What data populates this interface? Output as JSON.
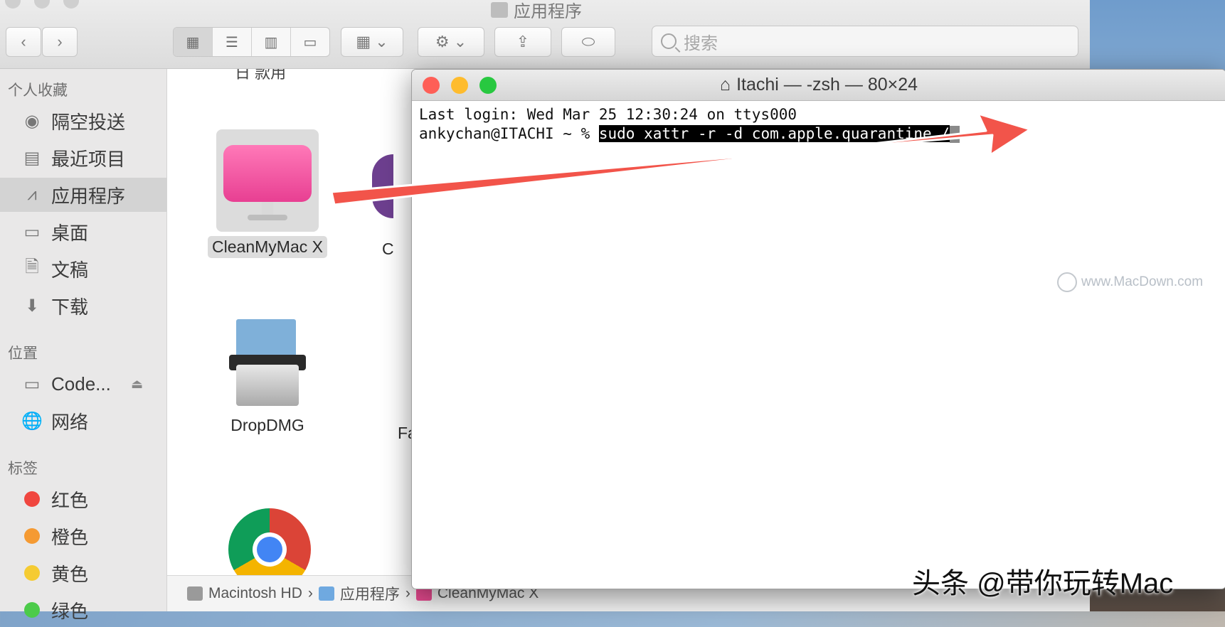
{
  "finder": {
    "title": "应用程序",
    "search_placeholder": "搜索",
    "sidebar": {
      "favorites_title": "个人收藏",
      "favorites": [
        {
          "label": "隔空投送",
          "icon": "airdrop-icon"
        },
        {
          "label": "最近项目",
          "icon": "recents-icon"
        },
        {
          "label": "应用程序",
          "icon": "applications-icon"
        },
        {
          "label": "桌面",
          "icon": "desktop-icon"
        },
        {
          "label": "文稿",
          "icon": "documents-icon"
        },
        {
          "label": "下载",
          "icon": "downloads-icon"
        }
      ],
      "locations_title": "位置",
      "locations": [
        {
          "label": "Code...",
          "icon": "disk-icon"
        },
        {
          "label": "网络",
          "icon": "network-icon"
        }
      ],
      "tags_title": "标签",
      "tags": [
        {
          "label": "红色",
          "color": "#f0463f"
        },
        {
          "label": "橙色",
          "color": "#f59a32"
        },
        {
          "label": "黄色",
          "color": "#f5cb32"
        },
        {
          "label": "绿色",
          "color": "#4ccb4a"
        }
      ]
    },
    "apps": [
      {
        "label": "CleanMyMac X"
      },
      {
        "label": "C"
      },
      {
        "label": "DropDMG"
      },
      {
        "label": "Fa"
      }
    ],
    "pathbar": [
      "Macintosh HD",
      "应用程序",
      "CleanMyMac X"
    ],
    "partial_top_label": "日 款用"
  },
  "terminal": {
    "title": "Itachi — -zsh — 80×24",
    "line1": "Last login: Wed Mar 25 12:30:24 on ttys000",
    "prompt": "ankychan@ITACHI ~ % ",
    "command": "sudo xattr -r -d com.apple.quarantine /"
  },
  "watermark": "www.MacDown.com",
  "credit": "头条 @带你玩转Mac",
  "colors": {
    "arrow": "#f2544a",
    "close": "#fe5f57",
    "minimize": "#febc2e",
    "zoom": "#28c840"
  }
}
